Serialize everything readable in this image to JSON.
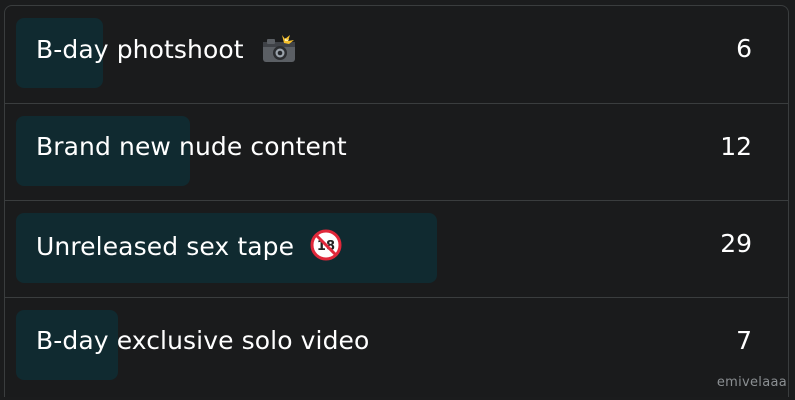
{
  "poll": {
    "options": [
      {
        "label": "B-day photshoot",
        "emoji": "camera-flash-icon",
        "votes": "6",
        "share": 0.11
      },
      {
        "label": "Brand new nude content",
        "emoji": "",
        "votes": "12",
        "share": 0.22
      },
      {
        "label": "Unreleased sex tape",
        "emoji": "no-under-18-icon",
        "votes": "29",
        "share": 0.54
      },
      {
        "label": "B-day exclusive solo video",
        "emoji": "",
        "votes": "7",
        "share": 0.13
      }
    ]
  },
  "watermark": "emivelaaa",
  "colors": {
    "background": "#1b1c1d",
    "bar": "#102a30",
    "divider": "#3a3d3e",
    "text": "#ffffff",
    "watermark": "#8b8f92"
  }
}
